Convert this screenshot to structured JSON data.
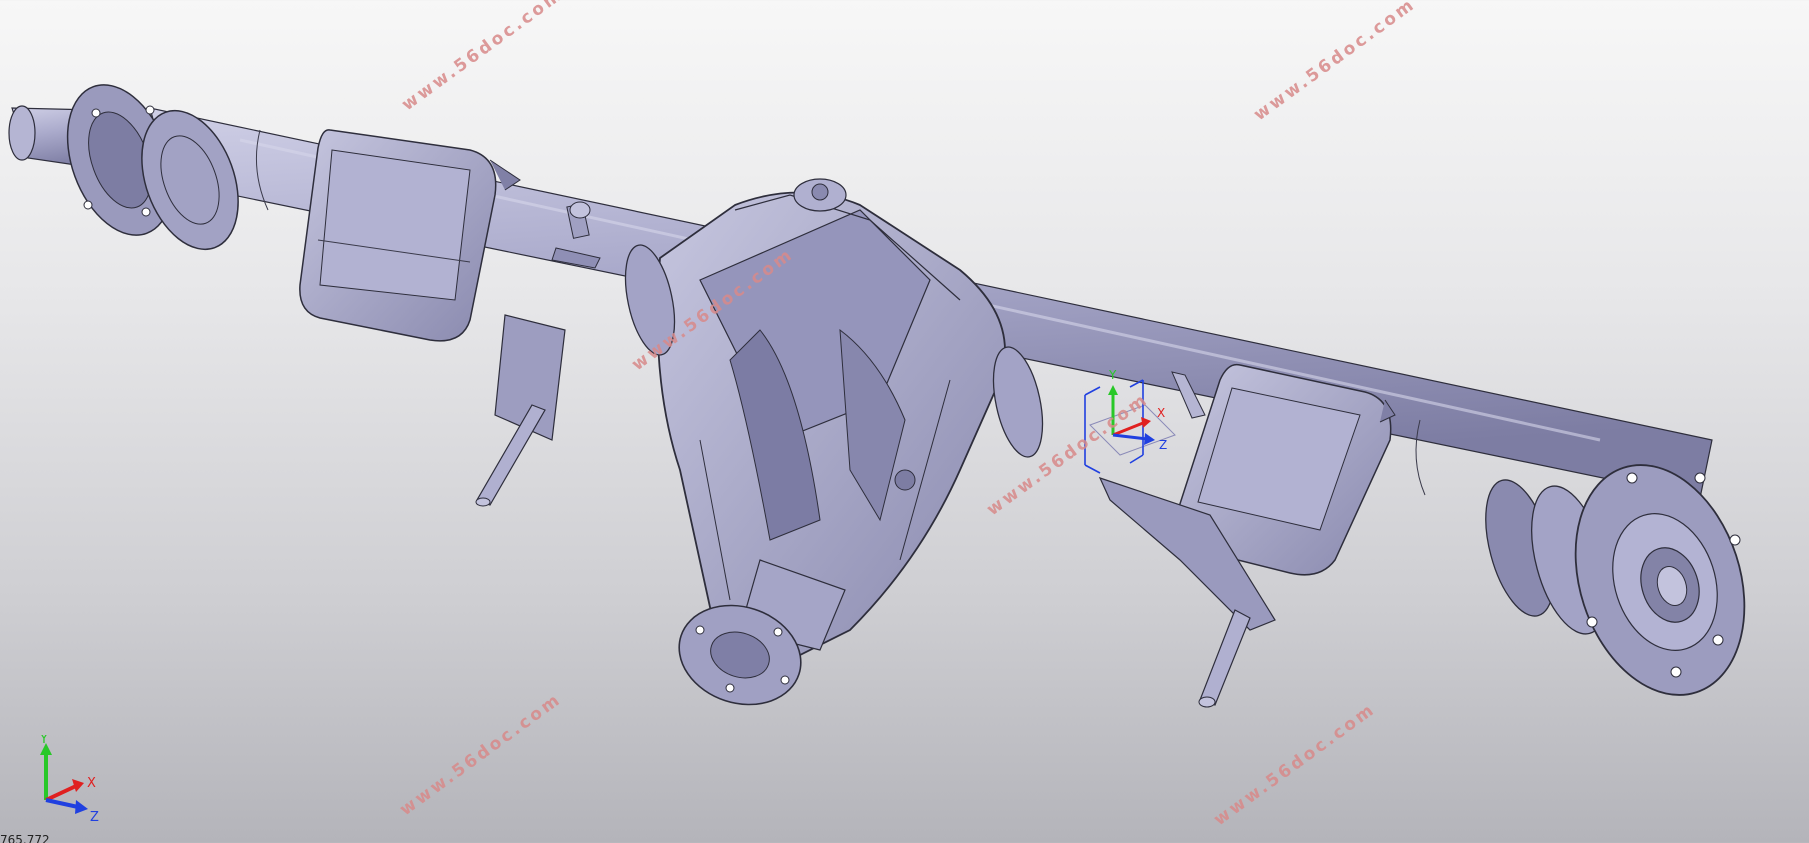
{
  "viewport": {
    "watermark_text": "www.56doc.com",
    "status_text": "765.772"
  },
  "triad": {
    "x_label": "X",
    "y_label": "Y",
    "z_label": "Z"
  },
  "compass": {
    "x_label": "X",
    "y_label": "Y",
    "z_label": "Z"
  },
  "colors": {
    "part_fill": "#a9a9c9",
    "part_shade": "#8383a7",
    "part_light": "#c3c3dd",
    "edge": "#2e2e3c",
    "axis_x": "#e02020",
    "axis_y": "#28c828",
    "axis_z": "#2040e0",
    "watermark": "#d88a8a"
  },
  "model": {
    "icon": "rear-axle-assembly-3d-model"
  }
}
